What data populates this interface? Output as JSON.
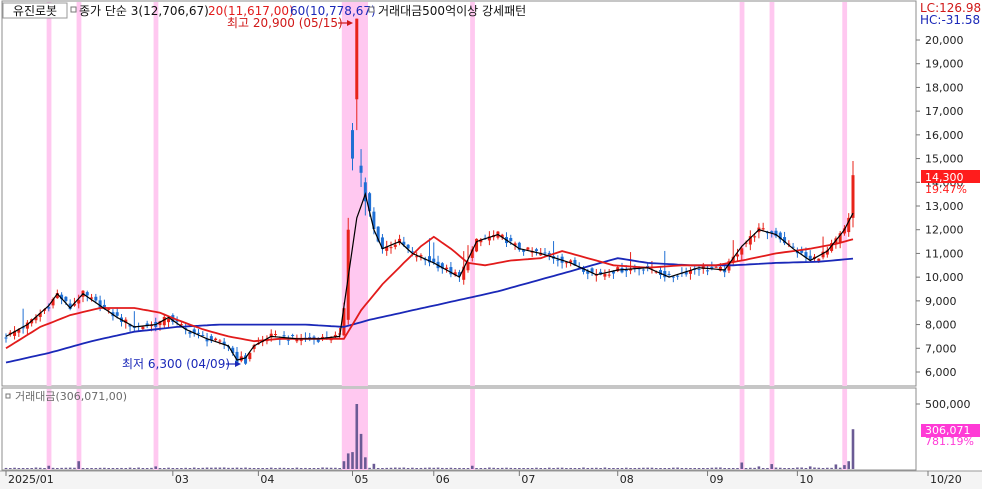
{
  "header": {
    "stock_name": "유진로봇",
    "legend_ma3": "종가 단순 3(12,706,67)",
    "legend_ma20": "20(11,617,00)",
    "legend_ma60": "60(10,778,67)",
    "legend_pattern": "거래대금500억이상 강세패턴"
  },
  "right_info": {
    "lc": "LC:126.98",
    "hc": "HC:-31.58"
  },
  "annotations": {
    "high": "최고 20,900 (05/15)",
    "low": "최저 6,300 (04/09)"
  },
  "current": {
    "price_tag": "14,300",
    "price_pct": "19.47%",
    "vol_tag": "306,071",
    "vol_pct": "781.19%"
  },
  "volume_panel": {
    "title": "거래대금(306,071,00)",
    "axis_label": "500,000"
  },
  "price_axis_labels": [
    "20,000",
    "19,000",
    "18,000",
    "17,000",
    "16,000",
    "15,000",
    "14,000",
    "13,000",
    "12,000",
    "11,000",
    "10,000",
    "9,000",
    "8,000",
    "7,000",
    "6,000"
  ],
  "x_axis_labels": [
    {
      "label": "2025/01",
      "day": 0
    },
    {
      "label": "03",
      "day": 39
    },
    {
      "label": "04",
      "day": 59
    },
    {
      "label": "05",
      "day": 81
    },
    {
      "label": "06",
      "day": 100
    },
    {
      "label": "07",
      "day": 120
    },
    {
      "label": "08",
      "day": 143
    },
    {
      "label": "09",
      "day": 164
    },
    {
      "label": "10",
      "day": 185
    },
    {
      "label": "10/20",
      "day": 210
    }
  ],
  "colors": {
    "up": "#e8231a",
    "down": "#1f6fd4",
    "ma3": "#000000",
    "ma20": "#e21b1b",
    "ma60": "#1a28b8",
    "highlight": "#ffc8f0",
    "tag_red": "#ff1c1c",
    "tag_pink": "#ff3ad6"
  },
  "chart_data": {
    "type": "candlestick",
    "y_range": [
      5400,
      21100
    ],
    "highlight_days": [
      10,
      17,
      35,
      79,
      80,
      81,
      82,
      83,
      84,
      109,
      172,
      179,
      196
    ],
    "series": [
      {
        "name": "3",
        "anchors": [
          [
            0,
            7500
          ],
          [
            5,
            8000
          ],
          [
            10,
            8800
          ],
          [
            12,
            9300
          ],
          [
            15,
            8700
          ],
          [
            18,
            9300
          ],
          [
            22,
            8800
          ],
          [
            26,
            8300
          ],
          [
            30,
            7900
          ],
          [
            35,
            8000
          ],
          [
            38,
            8300
          ],
          [
            42,
            7800
          ],
          [
            47,
            7400
          ],
          [
            52,
            7100
          ],
          [
            54,
            6500
          ],
          [
            56,
            6600
          ],
          [
            58,
            7100
          ],
          [
            62,
            7500
          ],
          [
            68,
            7400
          ],
          [
            73,
            7400
          ],
          [
            78,
            7500
          ],
          [
            80,
            10000
          ],
          [
            82,
            12500
          ],
          [
            84,
            13500
          ],
          [
            86,
            12000
          ],
          [
            88,
            11200
          ],
          [
            92,
            11500
          ],
          [
            95,
            11000
          ],
          [
            100,
            10600
          ],
          [
            106,
            10000
          ],
          [
            110,
            11500
          ],
          [
            115,
            11800
          ],
          [
            120,
            11200
          ],
          [
            125,
            11000
          ],
          [
            132,
            10600
          ],
          [
            138,
            10100
          ],
          [
            143,
            10300
          ],
          [
            150,
            10400
          ],
          [
            155,
            10000
          ],
          [
            162,
            10400
          ],
          [
            168,
            10300
          ],
          [
            172,
            11300
          ],
          [
            176,
            12000
          ],
          [
            180,
            11800
          ],
          [
            184,
            11200
          ],
          [
            188,
            10700
          ],
          [
            192,
            11100
          ],
          [
            196,
            12000
          ],
          [
            198,
            12700
          ]
        ]
      },
      {
        "name": "20",
        "anchors": [
          [
            0,
            7000
          ],
          [
            8,
            7900
          ],
          [
            15,
            8400
          ],
          [
            22,
            8700
          ],
          [
            30,
            8700
          ],
          [
            36,
            8500
          ],
          [
            40,
            8200
          ],
          [
            46,
            7800
          ],
          [
            52,
            7500
          ],
          [
            58,
            7300
          ],
          [
            64,
            7400
          ],
          [
            70,
            7400
          ],
          [
            76,
            7400
          ],
          [
            79,
            7400
          ],
          [
            83,
            8600
          ],
          [
            88,
            9700
          ],
          [
            93,
            10600
          ],
          [
            97,
            11300
          ],
          [
            100,
            11700
          ],
          [
            104,
            11200
          ],
          [
            108,
            10600
          ],
          [
            112,
            10500
          ],
          [
            118,
            10700
          ],
          [
            125,
            10800
          ],
          [
            130,
            11100
          ],
          [
            136,
            10800
          ],
          [
            142,
            10500
          ],
          [
            150,
            10400
          ],
          [
            158,
            10500
          ],
          [
            166,
            10500
          ],
          [
            172,
            10700
          ],
          [
            180,
            11000
          ],
          [
            188,
            11200
          ],
          [
            194,
            11400
          ],
          [
            198,
            11600
          ]
        ]
      },
      {
        "name": "60",
        "anchors": [
          [
            0,
            6400
          ],
          [
            10,
            6800
          ],
          [
            20,
            7300
          ],
          [
            30,
            7700
          ],
          [
            40,
            7900
          ],
          [
            50,
            8000
          ],
          [
            60,
            8000
          ],
          [
            70,
            8000
          ],
          [
            79,
            7900
          ],
          [
            85,
            8200
          ],
          [
            95,
            8600
          ],
          [
            105,
            9000
          ],
          [
            115,
            9400
          ],
          [
            125,
            9900
          ],
          [
            135,
            10400
          ],
          [
            143,
            10800
          ],
          [
            150,
            10600
          ],
          [
            160,
            10500
          ],
          [
            170,
            10500
          ],
          [
            180,
            10600
          ],
          [
            190,
            10650
          ],
          [
            198,
            10780
          ]
        ]
      }
    ],
    "candles_generated_from_series_3": true,
    "candle_overrides": [
      {
        "day": 80,
        "o": 8200,
        "c": 12000,
        "h": 12500,
        "l": 8000
      },
      {
        "day": 81,
        "o": 16200,
        "c": 15000,
        "h": 16500,
        "l": 14500
      },
      {
        "day": 82,
        "o": 17500,
        "c": 20900,
        "h": 20900,
        "l": 16200
      },
      {
        "day": 83,
        "o": 14700,
        "c": 14400,
        "h": 15400,
        "l": 13800
      },
      {
        "day": 84,
        "o": 14000,
        "c": 13200,
        "h": 14200,
        "l": 12600
      },
      {
        "day": 56,
        "o": 6700,
        "c": 6350,
        "h": 6800,
        "l": 6300
      },
      {
        "day": 198,
        "o": 12500,
        "c": 14300,
        "h": 14900,
        "l": 12100
      },
      {
        "day": 197,
        "o": 11900,
        "c": 12500,
        "h": 12700,
        "l": 11700
      }
    ],
    "volume": {
      "max": 500000,
      "base": 2500,
      "spikes": [
        [
          10,
          25000
        ],
        [
          17,
          60000
        ],
        [
          35,
          20000
        ],
        [
          79,
          60000
        ],
        [
          80,
          120000
        ],
        [
          81,
          130000
        ],
        [
          82,
          500000
        ],
        [
          83,
          270000
        ],
        [
          84,
          90000
        ],
        [
          86,
          40000
        ],
        [
          109,
          25000
        ],
        [
          172,
          50000
        ],
        [
          176,
          20000
        ],
        [
          179,
          38000
        ],
        [
          188,
          20000
        ],
        [
          194,
          35000
        ],
        [
          196,
          30000
        ],
        [
          197,
          60000
        ],
        [
          198,
          306071
        ]
      ]
    }
  }
}
